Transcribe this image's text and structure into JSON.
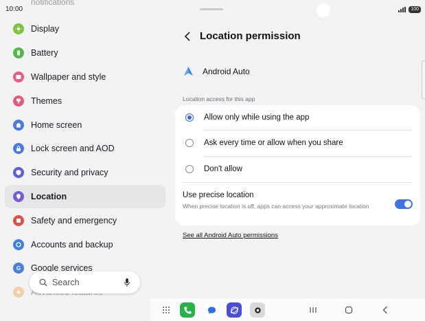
{
  "status": {
    "time": "10:00",
    "battery": "100"
  },
  "left": {
    "top_partial": "notifications",
    "menu": [
      {
        "label": "Display",
        "icon": "sun-icon",
        "color": "#7cc33b"
      },
      {
        "label": "Battery",
        "icon": "battery-icon",
        "color": "#55b948"
      },
      {
        "label": "Wallpaper and style",
        "icon": "image-icon",
        "color": "#e85d86"
      },
      {
        "label": "Themes",
        "icon": "brush-icon",
        "color": "#e05a7c"
      },
      {
        "label": "Home screen",
        "icon": "home-icon",
        "color": "#4a79e0"
      },
      {
        "label": "Lock screen and AOD",
        "icon": "lock-icon",
        "color": "#4a79e0"
      },
      {
        "label": "Security and privacy",
        "icon": "shield-icon",
        "color": "#5b5fd8"
      },
      {
        "label": "Location",
        "icon": "pin-icon",
        "color": "#7a5ad8"
      },
      {
        "label": "Safety and emergency",
        "icon": "alert-icon",
        "color": "#d9534a"
      },
      {
        "label": "Accounts and backup",
        "icon": "sync-icon",
        "color": "#3f7fde"
      },
      {
        "label": "Google services",
        "icon": "google-icon",
        "color": "#4a7fe0"
      },
      {
        "label": "Advanced features",
        "icon": "star-icon",
        "color": "#f1a44a"
      }
    ],
    "search": {
      "label": "Search"
    }
  },
  "right": {
    "title": "Location permission",
    "app_name": "Android Auto",
    "section_label": "Location access for this app",
    "options": [
      {
        "label": "Allow only while using the app",
        "selected": true
      },
      {
        "label": "Ask every time or allow when you share",
        "selected": false
      },
      {
        "label": "Don't allow",
        "selected": false
      }
    ],
    "precise": {
      "title": "Use precise location",
      "subtitle": "When precise location is off, apps can access your approximate location",
      "enabled": true
    },
    "see_all": "See all Android Auto permissions"
  },
  "colors": {
    "accent": "#3b6bd6",
    "toggle": "#3f74e0"
  }
}
